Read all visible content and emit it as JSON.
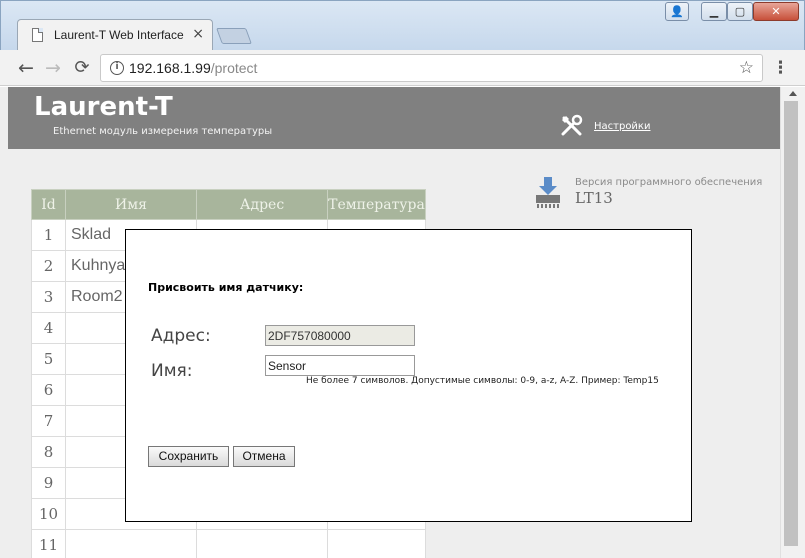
{
  "browser": {
    "tab_title": "Laurent-T Web Interface",
    "tab_close": "×",
    "url_host": "192.168.1.99",
    "url_path": "/protect",
    "back_icon": "←",
    "forward_icon": "→",
    "reload_icon": "⟳",
    "info_icon": "i",
    "star_icon": "☆",
    "menu_icon": "⋮",
    "win_user": "👤",
    "win_min": "▁",
    "win_max": "▢",
    "win_close": "✕"
  },
  "header": {
    "brand": "Laurent-T",
    "subtitle": "Ethernet модуль измерения температуры",
    "settings_label": "Настройки"
  },
  "firmware": {
    "label": "Версия программного обеспечения",
    "value": "LT13"
  },
  "table": {
    "headers": [
      "Id",
      "Имя",
      "Адрес",
      "Температура"
    ],
    "rows": [
      {
        "id": "1",
        "name": "Sklad"
      },
      {
        "id": "2",
        "name": "Kuhnya"
      },
      {
        "id": "3",
        "name": "Room2"
      },
      {
        "id": "4",
        "name": ""
      },
      {
        "id": "5",
        "name": ""
      },
      {
        "id": "6",
        "name": ""
      },
      {
        "id": "7",
        "name": ""
      },
      {
        "id": "8",
        "name": ""
      },
      {
        "id": "9",
        "name": ""
      },
      {
        "id": "10",
        "name": ""
      },
      {
        "id": "11",
        "name": ""
      }
    ]
  },
  "modal": {
    "title": "Присвоить имя датчику:",
    "address_label": "Адрес:",
    "address_value": "2DF757080000",
    "name_label": "Имя:",
    "name_value": "Sensor",
    "hint": "Не более 7 символов. Допустимые символы: 0-9, a-z, A-Z. Пример: Temp15",
    "save_label": "Сохранить",
    "cancel_label": "Отмена"
  }
}
